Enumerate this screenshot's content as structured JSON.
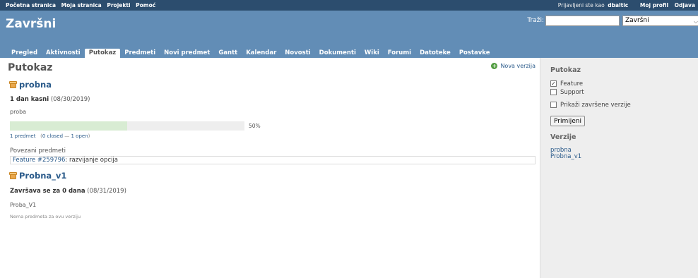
{
  "top_menu": {
    "items": [
      "Početna stranica",
      "Moja stranica",
      "Projekti",
      "Pomoć"
    ],
    "logged_as": "Prijavljeni ste kao",
    "username": "dbaltic",
    "my_profile": "Moj profil",
    "logout": "Odjava"
  },
  "header": {
    "project_title": "Završni",
    "search_label": "Traži:",
    "search_value": "",
    "project_select": "Završni"
  },
  "main_menu": {
    "tabs": [
      "Pregled",
      "Aktivnosti",
      "Putokaz",
      "Predmeti",
      "Novi predmet",
      "Gantt",
      "Kalendar",
      "Novosti",
      "Dokumenti",
      "Wiki",
      "Forumi",
      "Datoteke",
      "Postavke"
    ],
    "selected": "Putokaz"
  },
  "content": {
    "page_title": "Putokaz",
    "new_version": "Nova verzija",
    "versions": [
      {
        "name": "probna",
        "due_status": "1 dan kasni",
        "due_date": "(08/30/2019)",
        "description": "proba",
        "progress_percent": 50,
        "progress_label": "50%",
        "issue_count_link": "1 predmet",
        "closed_link": "0 closed",
        "open_link": "1 open",
        "related_heading": "Povezani predmeti",
        "related_issue_link": "Feature #259796",
        "related_issue_title": ": razvijanje opcija"
      },
      {
        "name": "Probna_v1",
        "due_status": "Završava se za 0 dana",
        "due_date": "(08/31/2019)",
        "description": "Proba_V1",
        "no_issues": "Nema predmeta za ovu verziju"
      }
    ]
  },
  "sidebar": {
    "roadmap_heading": "Putokaz",
    "trackers": [
      {
        "label": "Feature",
        "checked": true
      },
      {
        "label": "Support",
        "checked": false
      }
    ],
    "show_completed": {
      "label": "Prikaži završene verzije",
      "checked": false
    },
    "apply_button": "Primijeni",
    "versions_heading": "Verzije",
    "version_links": [
      "probna",
      "Probna_v1"
    ]
  },
  "colors": {
    "top_menu_bg": "#2c4d6e",
    "header_bg": "#628db6",
    "link": "#2a5a8a",
    "progress_done": "#d8ecd3",
    "sidebar_bg": "#eeeeee"
  }
}
